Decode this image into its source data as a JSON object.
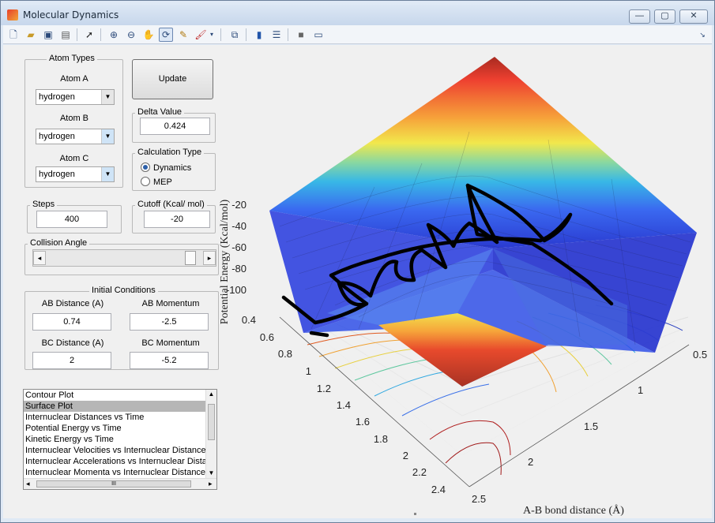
{
  "window": {
    "title": "Molecular Dynamics",
    "minimize": "—",
    "maximize": "▢",
    "close": "✕"
  },
  "toolbar": {
    "icons": [
      "new-file-icon",
      "open-folder-icon",
      "save-icon",
      "print-icon",
      "pointer-icon",
      "zoom-in-icon",
      "zoom-out-icon",
      "pan-hand-icon",
      "rotate-3d-icon",
      "data-cursor-icon",
      "brush-icon",
      "link-plot-icon",
      "colorbar-icon",
      "legend-icon",
      "hide-plot-tools-icon",
      "show-plot-tools-icon"
    ],
    "active": "rotate-3d-icon"
  },
  "controls": {
    "atom_types_title": "Atom Types",
    "atom_a_label": "Atom A",
    "atom_a_value": "hydrogen",
    "atom_b_label": "Atom B",
    "atom_b_value": "hydrogen",
    "atom_c_label": "Atom C",
    "atom_c_value": "hydrogen",
    "update_label": "Update",
    "delta_title": "Delta Value",
    "delta_value": "0.424",
    "calc_type_title": "Calculation Type",
    "calc_dynamics": "Dynamics",
    "calc_mep": "MEP",
    "calc_selected": "Dynamics",
    "steps_title": "Steps",
    "steps_value": "400",
    "cutoff_title": "Cutoff (Kcal/ mol)",
    "cutoff_value": "-20",
    "collision_title": "Collision Angle",
    "collision_value": 0.95,
    "initial_title": "Initial Conditions",
    "ab_distance_label": "AB Distance (A)",
    "ab_distance_value": "0.74",
    "ab_momentum_label": "AB Momentum",
    "ab_momentum_value": "-2.5",
    "bc_distance_label": "BC Distance (A)",
    "bc_distance_value": "2",
    "bc_momentum_label": "BC Momentum",
    "bc_momentum_value": "-5.2"
  },
  "plot_list": {
    "items": [
      "Contour Plot",
      "Surface Plot",
      "Internuclear Distances vs Time",
      "Potential Energy vs Time",
      "Kinetic Energy vs Time",
      "Internuclear Velocities vs Internuclear Distance",
      "Internuclear Accelerations vs Internuclear Distance",
      "Internuclear Momenta vs Internuclear Distance"
    ],
    "selected_index": 1,
    "hscroll_label": "III"
  },
  "plot": {
    "zlabel": "Potential Energy (Kcal/mol)",
    "xlabel": "A-B bond distance (Å)",
    "z_ticks": [
      "-20",
      "-40",
      "-60",
      "-80",
      "-100"
    ],
    "y_ticks": [
      "0.4",
      "0.6",
      "0.8",
      "1",
      "1.2",
      "1.4",
      "1.6",
      "1.8",
      "2",
      "2.2",
      "2.4"
    ],
    "x_ticks": [
      "0.5",
      "1",
      "1.5",
      "2",
      "2.5"
    ]
  }
}
